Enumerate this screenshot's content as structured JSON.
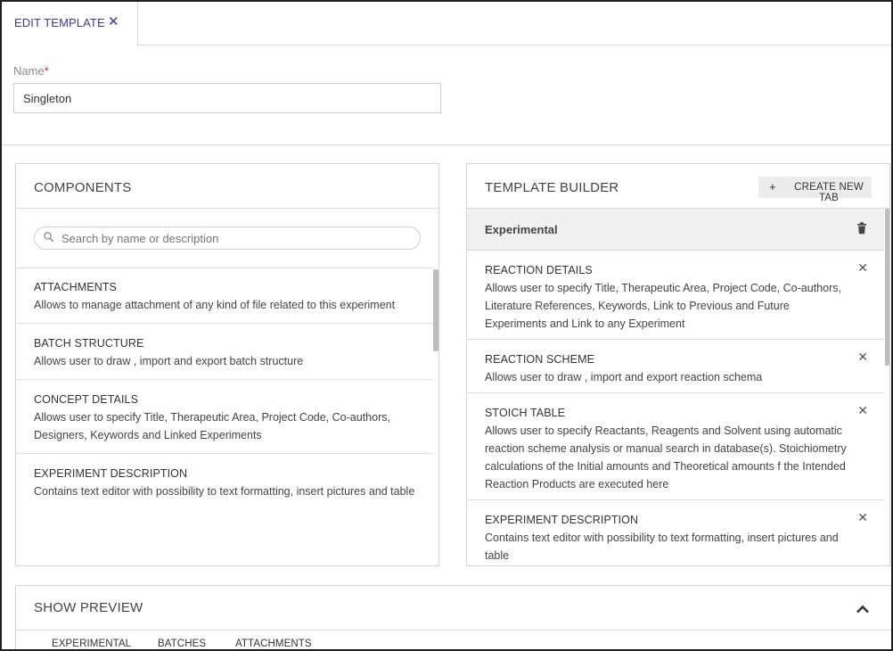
{
  "tabs": {
    "active_label": "EDIT TEMPLATE",
    "close_glyph": "✕"
  },
  "name_field": {
    "label": "Name",
    "required_mark": "*",
    "value": "Singleton"
  },
  "components": {
    "title": "COMPONENTS",
    "search_placeholder": "Search by name or description",
    "items": [
      {
        "title": "ATTACHMENTS",
        "desc": "Allows to manage attachment of any kind of file related to this experiment"
      },
      {
        "title": "BATCH STRUCTURE",
        "desc": "Allows user to draw , import and export batch structure"
      },
      {
        "title": "CONCEPT DETAILS",
        "desc": "Allows user to specify Title, Therapeutic Area, Project Code, Co-authors, Designers, Keywords and Linked Experiments"
      },
      {
        "title": "EXPERIMENT DESCRIPTION",
        "desc": "Contains text editor with possibility to text formatting, insert pictures and table"
      }
    ],
    "scrollbar_position": 0.0
  },
  "builder": {
    "title": "TEMPLATE BUILDER",
    "create_tab_plus": "+",
    "create_tab_label": "CREATE NEW TAB",
    "section_title": "Experimental",
    "items": [
      {
        "title": "REACTION DETAILS",
        "desc": "Allows user to specify Title, Therapeutic Area, Project Code, Co-authors, Literature References, Keywords, Link to Previous and Future Experiments and Link to any Experiment"
      },
      {
        "title": "REACTION SCHEME",
        "desc": "Allows user to draw , import and export reaction schema"
      },
      {
        "title": "STOICH TABLE",
        "desc": "Allows user to specify Reactants, Reagents and Solvent using automatic reaction scheme analysis or manual search in database(s). Stoichiometry calculations of the Initial amounts and Theoretical amounts f the Intended Reaction Products are executed here"
      },
      {
        "title": "EXPERIMENT DESCRIPTION",
        "desc": "Contains text editor with possibility to text formatting, insert pictures and table"
      }
    ],
    "remove_glyph": "✕"
  },
  "preview": {
    "title": "SHOW PREVIEW",
    "tabs": [
      "EXPERIMENTAL",
      "BATCHES",
      "ATTACHMENTS"
    ]
  },
  "colors": {
    "accent_tab": "#3b3b9b",
    "required": "#c62828",
    "section_header_bg": "#f0f0f0",
    "button_bg": "#ececec"
  },
  "icons": [
    "close-icon",
    "search-icon",
    "plus-icon",
    "trash-icon",
    "remove-icon",
    "chevron-up-icon"
  ]
}
